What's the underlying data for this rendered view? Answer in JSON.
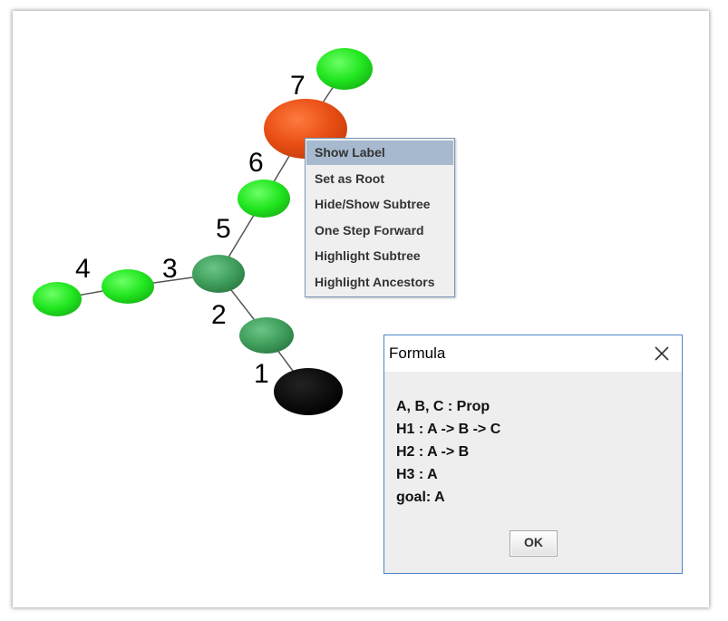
{
  "tree": {
    "node_labels": [
      "1",
      "2",
      "3",
      "4",
      "5",
      "6",
      "7"
    ],
    "colors": {
      "root": "#000000",
      "selected": "#e84e14",
      "bright_green": "#21e61f",
      "dark_green": "#3f9e5b",
      "edge": "#555555"
    }
  },
  "context_menu": {
    "items": [
      {
        "label": "Show Label",
        "selected": true
      },
      {
        "label": "Set as Root",
        "selected": false
      },
      {
        "label": "Hide/Show Subtree",
        "selected": false
      },
      {
        "label": "One Step Forward",
        "selected": false
      },
      {
        "label": "Highlight Subtree",
        "selected": false
      },
      {
        "label": "Highlight Ancestors",
        "selected": false
      }
    ]
  },
  "dialog": {
    "title": "Formula",
    "lines": [
      "A, B, C : Prop",
      "H1 : A -> B -> C",
      "H2 : A -> B",
      "H3 : A",
      "goal: A"
    ],
    "ok_label": "OK",
    "close_icon": "close-icon"
  }
}
